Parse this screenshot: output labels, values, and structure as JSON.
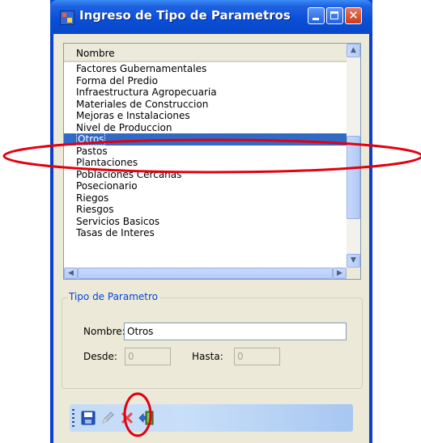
{
  "window": {
    "title": "Ingreso de Tipo de Parametros",
    "close_glyph": "✕"
  },
  "list": {
    "column_header": "Nombre",
    "rows": [
      "Factores Gubernamentales",
      "Forma del Predio",
      "Infraestructura Agropecuaria",
      "Materiales de Construccion",
      "Mejoras e Instalaciones",
      "Nivel de Produccion",
      "Otros",
      "Pastos",
      "Plantaciones",
      "Poblaciones Cercanas",
      "Posecionario",
      "Riegos",
      "Riesgos",
      "Servicios Basicos",
      "Tasas de Interes"
    ],
    "selected_row": "Otros"
  },
  "group": {
    "title": "Tipo de Parametro",
    "nombre_label": "Nombre:",
    "nombre_value": "Otros",
    "desde_label": "Desde:",
    "desde_value": "0",
    "hasta_label": "Hasta:",
    "hasta_value": "0"
  },
  "toolbar": {
    "icons": [
      "save-icon",
      "edit-icon",
      "delete-icon",
      "exit-icon"
    ]
  },
  "colors": {
    "title_bar": "#0a4fd9",
    "selection": "#316ac5",
    "annotation": "#e3000f",
    "group_title": "#0046d5"
  }
}
